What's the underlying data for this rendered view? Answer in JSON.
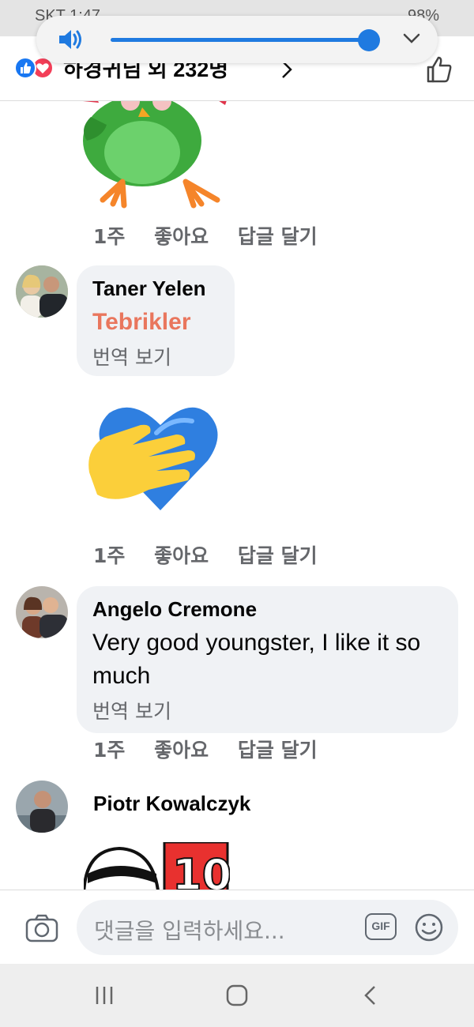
{
  "status_bar": {
    "carrier_time": "SKT 1:47",
    "battery": "98%"
  },
  "volume": {
    "level": 0.99,
    "accent": "#1f7ae0"
  },
  "header": {
    "title": "하경귀님 외 232명"
  },
  "comments": [
    {
      "author": "",
      "text": "",
      "translate": "",
      "time": "1주",
      "like": "좋아요",
      "reply": "답글 달기",
      "sticker": "parrot-sticker"
    },
    {
      "author": "Taner Yelen",
      "text": "Tebrikler",
      "translate": "번역 보기",
      "time": "1주",
      "like": "좋아요",
      "reply": "답글 달기",
      "sticker": "heart-hand-sticker"
    },
    {
      "author": "Angelo Cremone",
      "text": "Very good youngster, I like it so much",
      "translate": "번역 보기",
      "time": "1주",
      "like": "좋아요",
      "reply": "답글 달기"
    },
    {
      "author": "Piotr Kowalczyk",
      "sticker": "number-ten-sticker"
    }
  ],
  "composer": {
    "placeholder": "댓글을 입력하세요...",
    "gif_label": "GIF"
  },
  "colors": {
    "like_blue": "#1877f2",
    "love_red": "#f33e58",
    "bubble_bg": "#f0f2f5",
    "secondary_text": "#65676b"
  }
}
